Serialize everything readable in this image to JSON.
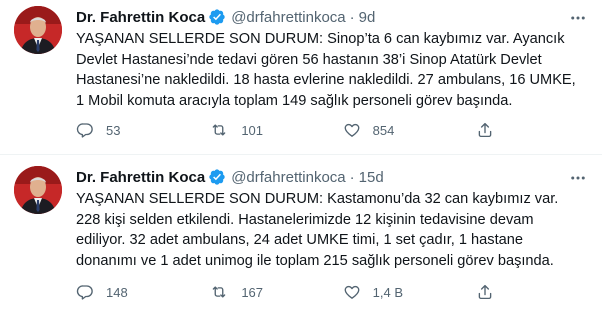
{
  "tweets": [
    {
      "author_name": "Dr. Fahrettin Koca",
      "handle": "@drfahrettinkoca",
      "separator": "·",
      "time": "9d",
      "lines": [
        "YAŞANAN SELLERDE SON DURUM: Sinop’ta 6 can kaybımız var. Ayancık",
        "Devlet Hastanesi’nde tedavi gören 56 hastanın 38’i Sinop Atatürk Devlet",
        "Hastanesi’ne nakledildi. 18 hasta evlerine nakledildi. 27 ambulans, 16 UMKE,",
        "1 Mobil komuta aracıyla toplam 149 sağlık personeli görev başında."
      ],
      "replies": "53",
      "retweets": "101",
      "likes": "854"
    },
    {
      "author_name": "Dr. Fahrettin Koca",
      "handle": "@drfahrettinkoca",
      "separator": "·",
      "time": "15d",
      "lines": [
        "YAŞANAN SELLERDE SON DURUM: Kastamonu’da 32 can kaybımız var.",
        "228 kişi selden etkilendi. Hastanelerimizde 12 kişinin tedavisine devam",
        "ediliyor. 32 adet ambulans, 24 adet UMKE timi, 1 set çadır, 1 hastane",
        "donanımı ve 1 adet unimog ile toplam 215 sağlık personeli görev başında."
      ],
      "replies": "148",
      "retweets": "167",
      "likes": "1,4 B"
    }
  ],
  "icons": {
    "verified": "verified-badge-icon",
    "more": "more-horizontal-icon",
    "reply": "reply-icon",
    "retweet": "retweet-icon",
    "like": "like-heart-icon",
    "share": "share-icon"
  },
  "colors": {
    "text": "#0f1419",
    "secondary": "#536471",
    "verified": "#1d9bf0",
    "divider": "#eff3f4",
    "avatar_bg": "#b71c1c"
  }
}
